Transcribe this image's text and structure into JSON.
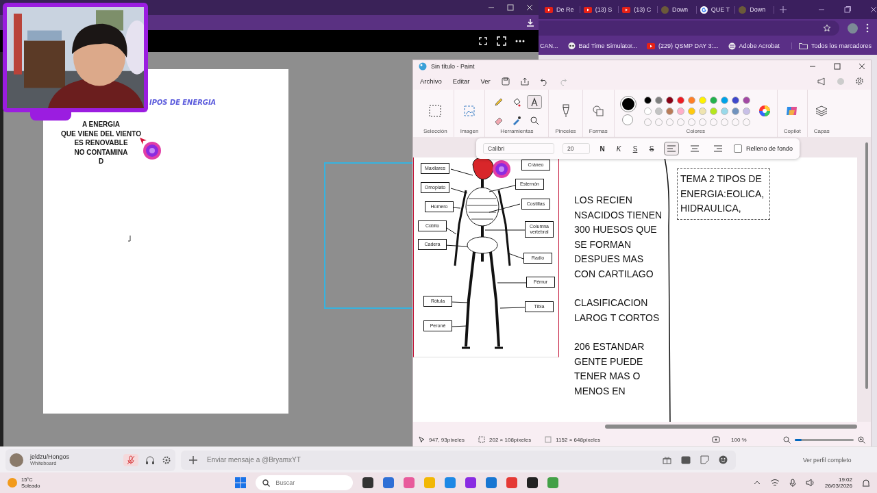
{
  "viewer": {
    "slide_title": "IPOS DE ENERGIA",
    "slide_lines": [
      "A ENERGIA",
      "QUE VIENE DEL VIENTO",
      "ES RENOVABLE",
      "NO CONTAMINA",
      "D"
    ]
  },
  "browser": {
    "tabs": [
      {
        "kind": "youtube",
        "label": "De Re"
      },
      {
        "kind": "youtube",
        "label": "(13) S"
      },
      {
        "kind": "youtube",
        "label": "(13) C"
      },
      {
        "kind": "site",
        "label": "Down"
      },
      {
        "kind": "google",
        "label": "QUE T"
      },
      {
        "kind": "site",
        "label": "Down"
      }
    ],
    "bookmarks": [
      {
        "kind": "none",
        "label": "CAN..."
      },
      {
        "kind": "skull",
        "label": "Bad Time Simulator..."
      },
      {
        "kind": "youtube",
        "label": "(229) QSMP DAY 3:..."
      },
      {
        "kind": "globe",
        "label": "Adobe Acrobat"
      },
      {
        "kind": "folder",
        "label": "Todos los marcadores"
      }
    ]
  },
  "paint": {
    "title": "Sin título - Paint",
    "menu": [
      "Archivo",
      "Editar",
      "Ver"
    ],
    "tools": [
      {
        "kind": "pencil",
        "selected": false
      },
      {
        "kind": "fill",
        "selected": false
      },
      {
        "kind": "text",
        "selected": true
      },
      {
        "kind": "eraser",
        "selected": false
      },
      {
        "kind": "picker",
        "selected": false
      },
      {
        "kind": "magnifier",
        "selected": false
      }
    ],
    "groups": [
      "Selección",
      "Imagen",
      "Herramientas",
      "Pinceles",
      "Formas",
      "Colores",
      "Copilot",
      "Capas"
    ],
    "palette": [
      {
        "color": "#000000"
      },
      {
        "color": "#7f7f7f"
      },
      {
        "color": "#880015"
      },
      {
        "color": "#ed1c24"
      },
      {
        "color": "#ff7f27"
      },
      {
        "color": "#fff200"
      },
      {
        "color": "#22b14c"
      },
      {
        "color": "#00a2e8"
      },
      {
        "color": "#3f48cc"
      },
      {
        "color": "#a349a4"
      },
      {
        "color": "#ffffff"
      },
      {
        "color": "#c3c3c3"
      },
      {
        "color": "#b97a57"
      },
      {
        "color": "#ffaec9"
      },
      {
        "color": "#ffc90e"
      },
      {
        "color": "#efe4b0"
      },
      {
        "color": "#b5e61d"
      },
      {
        "color": "#99d9ea"
      },
      {
        "color": "#7092be"
      },
      {
        "color": "#c8bfe7"
      }
    ],
    "text_bar": {
      "font": "Calibri",
      "size": "20",
      "styles": [
        {
          "kind": "bold",
          "label": "N"
        },
        {
          "kind": "italic",
          "label": "K"
        },
        {
          "kind": "underline",
          "label": "S"
        },
        {
          "kind": "strike",
          "label": "S"
        }
      ],
      "align": [
        {
          "kind": "left",
          "selected": true
        },
        {
          "kind": "center",
          "selected": false
        },
        {
          "kind": "right",
          "selected": false
        }
      ],
      "fill_background": {
        "label": "Relleno de fondo",
        "checked": false
      }
    },
    "bone_labels": [
      {
        "label": "Maxilares"
      },
      {
        "label": "Omoplato"
      },
      {
        "label": "Húmero"
      },
      {
        "label": "Cúbito"
      },
      {
        "label": "Cadera"
      },
      {
        "label": "Rótula"
      },
      {
        "label": "Peroné"
      },
      {
        "label": "Cráneo"
      },
      {
        "label": "Esternón"
      },
      {
        "label": "Costillas"
      },
      {
        "label": "Columna vertebral"
      },
      {
        "label": "Radio"
      },
      {
        "label": "Fémur"
      },
      {
        "label": "Tibia"
      }
    ],
    "notes": [
      "LOS RECIEN NSACIDOS TIENEN 300 HUESOS QUE SE FORMAN DESPUES MAS CON CARTILAGO",
      "CLASIFICACION LAROG T CORTOS",
      "206 ESTANDAR GENTE PUEDE TENER MAS O MENOS EN"
    ],
    "text_box": "TEMA 2 TIPOS DE ENERGIA:EOLICA, HIDRAULICA,",
    "status": {
      "cursor": "947, 93píxeles",
      "selection": "202 × 108píxeles",
      "canvas": "1152 × 648píxeles",
      "zoom": "100 %",
      "zoom_level": {
        "level": 0.12
      }
    }
  },
  "chat": {
    "user": "jeldzu/Hongos",
    "activity": "Whiteboard",
    "muted": true,
    "placeholder": "Enviar mensaje a @BryamxYT",
    "profile_link": "Ver perfil completo"
  },
  "taskbar": {
    "temperature": "15°C",
    "weather": "Soleado",
    "search_placeholder": "Buscar",
    "time": "19:02",
    "date": "26/03/2026"
  }
}
